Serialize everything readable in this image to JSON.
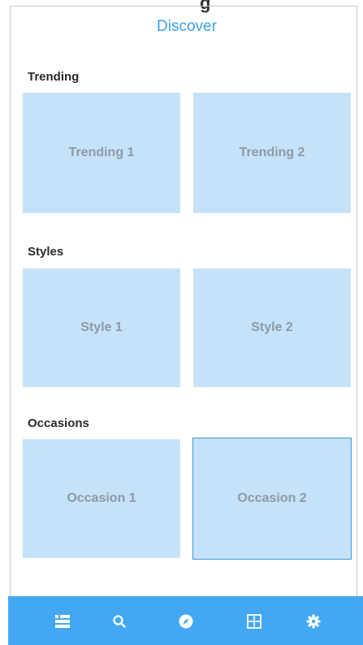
{
  "header": {
    "title": "Discover"
  },
  "sections": [
    {
      "title": "Trending",
      "cards": [
        {
          "label": "Trending 1"
        },
        {
          "label": "Trending 2"
        }
      ]
    },
    {
      "title": "Styles",
      "cards": [
        {
          "label": "Style 1"
        },
        {
          "label": "Style 2"
        }
      ]
    },
    {
      "title": "Occasions",
      "cards": [
        {
          "label": "Occasion 1"
        },
        {
          "label": "Occasion 2",
          "selected": true
        }
      ]
    }
  ],
  "tabbar": {
    "background_color": "#43a8f3",
    "items": [
      {
        "icon": "list-icon"
      },
      {
        "icon": "search-icon"
      },
      {
        "icon": "compass-icon"
      },
      {
        "icon": "grid-icon"
      },
      {
        "icon": "gear-icon"
      }
    ]
  },
  "colors": {
    "accent": "#3aa0e8",
    "card_fill": "#c6e2f8",
    "card_text": "#8e9aa6"
  }
}
